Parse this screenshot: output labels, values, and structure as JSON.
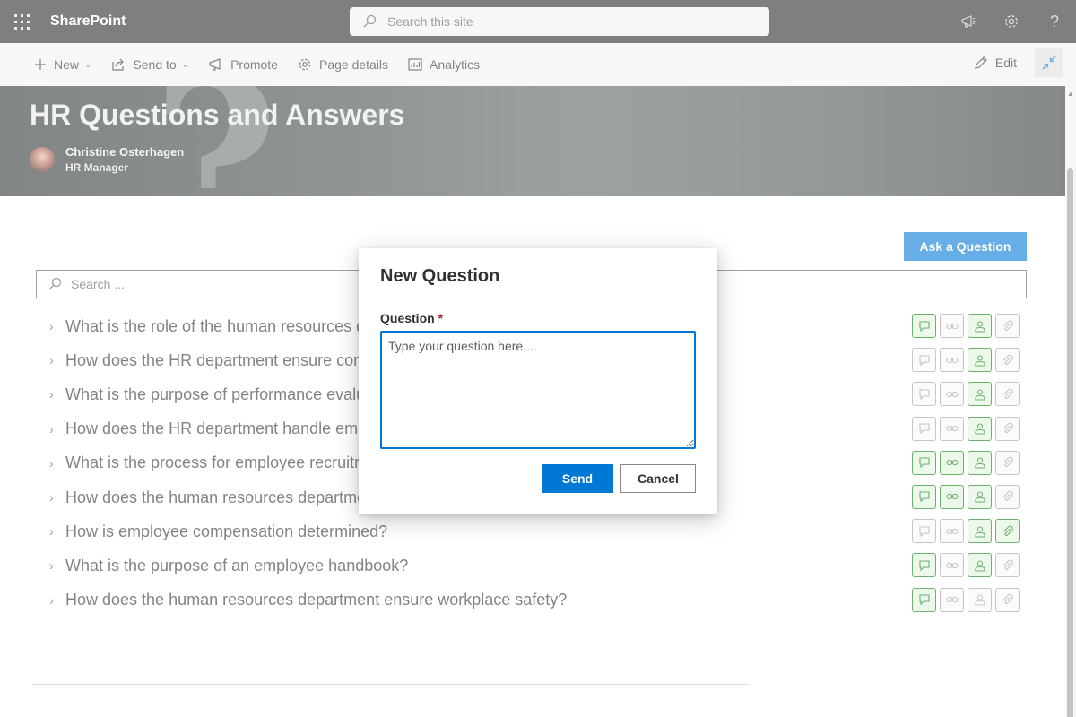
{
  "suitebar": {
    "app_name": "SharePoint",
    "search_placeholder": "Search this site",
    "icons": [
      "app-launcher-icon",
      "megaphone-icon",
      "gear-icon",
      "help-icon"
    ],
    "help_glyph": "?"
  },
  "commandbar": {
    "new_label": "New",
    "send_to_label": "Send to",
    "promote_label": "Promote",
    "page_details_label": "Page details",
    "analytics_label": "Analytics",
    "edit_label": "Edit"
  },
  "hero": {
    "title": "HR Questions and Answers",
    "author_name": "Christine Osterhagen",
    "author_role": "HR Manager"
  },
  "main": {
    "ask_button_label": "Ask a Question",
    "search_placeholder": "Search ...",
    "questions": [
      {
        "text": "What is the role of the human resources d",
        "flags": [
          true,
          false,
          true,
          false
        ]
      },
      {
        "text": "How does the HR department ensure com",
        "flags": [
          false,
          false,
          true,
          false
        ]
      },
      {
        "text": "What is the purpose of performance evalu",
        "flags": [
          false,
          false,
          true,
          false
        ]
      },
      {
        "text": "How does the HR department handle em",
        "flags": [
          false,
          false,
          true,
          false
        ]
      },
      {
        "text": "What is the process for employee recruitr",
        "flags": [
          true,
          true,
          true,
          false
        ]
      },
      {
        "text": "How does the human resources departme",
        "flags": [
          true,
          true,
          true,
          false
        ]
      },
      {
        "text": "How is employee compensation determined?",
        "flags": [
          false,
          false,
          true,
          true
        ]
      },
      {
        "text": "What is the purpose of an employee handbook?",
        "flags": [
          true,
          false,
          true,
          false
        ]
      },
      {
        "text": "How does the human resources department ensure workplace safety?",
        "flags": [
          true,
          false,
          false,
          false
        ]
      }
    ],
    "row_icon_names": [
      "comment-icon",
      "link-icon",
      "person-icon",
      "attachment-icon"
    ]
  },
  "dialog": {
    "title": "New Question",
    "question_label": "Question",
    "required_marker": "*",
    "question_placeholder": "Type your question here...",
    "question_value": "",
    "send_label": "Send",
    "cancel_label": "Cancel"
  },
  "colors": {
    "accent": "#0078d4",
    "active_icon_border": "#107c10",
    "active_icon_fill": "#dff6dd",
    "suitebar_bg": "#2b2b2b"
  }
}
